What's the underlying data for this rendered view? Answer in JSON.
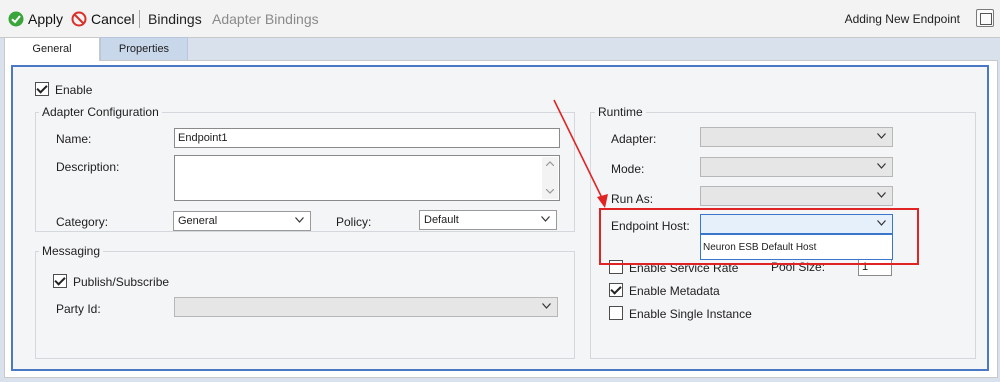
{
  "toolbar": {
    "apply_label": "Apply",
    "cancel_label": "Cancel",
    "bindings_label": "Bindings",
    "adapter_bindings_label": "Adapter Bindings",
    "status": "Adding New Endpoint"
  },
  "tabs": [
    {
      "label": "General",
      "selected": true
    },
    {
      "label": "Properties",
      "selected": false
    }
  ],
  "general": {
    "enable_label": "Enable",
    "enable_checked": true
  },
  "adapter_configuration": {
    "title": "Adapter Configuration",
    "name_label": "Name:",
    "name_value": "Endpoint1",
    "description_label": "Description:",
    "description_value": "",
    "category_label": "Category:",
    "category_value": "General",
    "policy_label": "Policy:",
    "policy_value": "Default"
  },
  "messaging": {
    "title": "Messaging",
    "publish_subscribe_label": "Publish/Subscribe",
    "publish_subscribe_checked": true,
    "party_id_label": "Party Id:",
    "party_id_value": ""
  },
  "runtime": {
    "title": "Runtime",
    "adapter_label": "Adapter:",
    "adapter_value": "",
    "mode_label": "Mode:",
    "mode_value": "",
    "run_as_label": "Run As:",
    "run_as_value": "",
    "endpoint_host_label": "Endpoint Host:",
    "endpoint_host_value": "",
    "endpoint_host_options": [
      "Neuron ESB Default Host"
    ],
    "enable_service_rate_label": "Enable Service Rate",
    "enable_service_rate_checked": false,
    "pool_size_label": "Pool Size:",
    "pool_size_value": "1",
    "enable_metadata_label": "Enable Metadata",
    "enable_metadata_checked": true,
    "enable_single_instance_label": "Enable Single Instance",
    "enable_single_instance_checked": false
  },
  "colors": {
    "frame_accent": "#4a78c4",
    "annotation_red": "#e02424",
    "apply_green": "#3aa53a",
    "cancel_red": "#d9302a"
  }
}
